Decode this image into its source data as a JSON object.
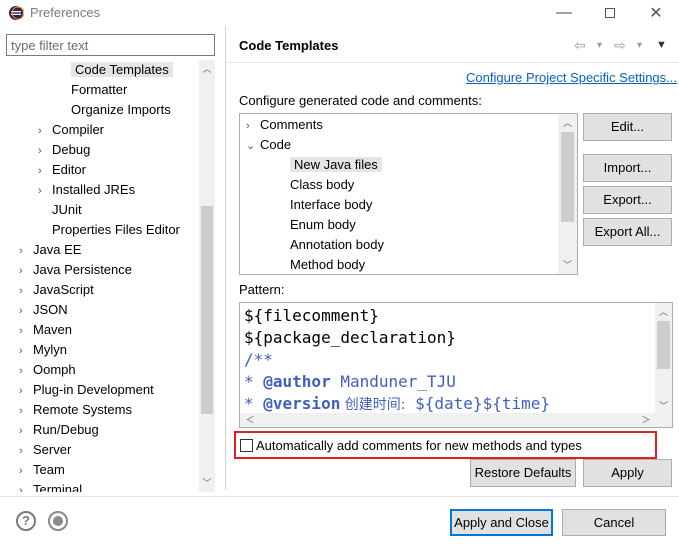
{
  "window": {
    "title": "Preferences",
    "minimize": "—",
    "close": "✕"
  },
  "filter": {
    "placeholder": "type filter text"
  },
  "left_tree": {
    "items": [
      {
        "label": "Code Templates",
        "indent": 3,
        "arrow": "",
        "selected": true
      },
      {
        "label": "Formatter",
        "indent": 3,
        "arrow": ""
      },
      {
        "label": "Organize Imports",
        "indent": 3,
        "arrow": ""
      },
      {
        "label": "Compiler",
        "indent": 2,
        "arrow": ">"
      },
      {
        "label": "Debug",
        "indent": 2,
        "arrow": ">"
      },
      {
        "label": "Editor",
        "indent": 2,
        "arrow": ">"
      },
      {
        "label": "Installed JREs",
        "indent": 2,
        "arrow": ">"
      },
      {
        "label": "JUnit",
        "indent": 2,
        "arrow": ""
      },
      {
        "label": "Properties Files Editor",
        "indent": 2,
        "arrow": ""
      },
      {
        "label": "Java EE",
        "indent": 1,
        "arrow": ">"
      },
      {
        "label": "Java Persistence",
        "indent": 1,
        "arrow": ">"
      },
      {
        "label": "JavaScript",
        "indent": 1,
        "arrow": ">"
      },
      {
        "label": "JSON",
        "indent": 1,
        "arrow": ">"
      },
      {
        "label": "Maven",
        "indent": 1,
        "arrow": ">"
      },
      {
        "label": "Mylyn",
        "indent": 1,
        "arrow": ">"
      },
      {
        "label": "Oomph",
        "indent": 1,
        "arrow": ">"
      },
      {
        "label": "Plug-in Development",
        "indent": 1,
        "arrow": ">"
      },
      {
        "label": "Remote Systems",
        "indent": 1,
        "arrow": ">"
      },
      {
        "label": "Run/Debug",
        "indent": 1,
        "arrow": ">"
      },
      {
        "label": "Server",
        "indent": 1,
        "arrow": ">"
      },
      {
        "label": "Team",
        "indent": 1,
        "arrow": ">"
      },
      {
        "label": "Terminal",
        "indent": 1,
        "arrow": ">"
      }
    ]
  },
  "header": {
    "title": "Code Templates",
    "configure_link": "Configure Project Specific Settings...",
    "description": "Configure generated code and comments:"
  },
  "templates_tree": {
    "items": [
      {
        "label": "Comments",
        "indent": 0,
        "arrow": ">"
      },
      {
        "label": "Code",
        "indent": 0,
        "arrow": "v"
      },
      {
        "label": "New Java files",
        "indent": 1,
        "arrow": "",
        "selected": true
      },
      {
        "label": "Class body",
        "indent": 1,
        "arrow": ""
      },
      {
        "label": "Interface body",
        "indent": 1,
        "arrow": ""
      },
      {
        "label": "Enum body",
        "indent": 1,
        "arrow": ""
      },
      {
        "label": "Annotation body",
        "indent": 1,
        "arrow": ""
      },
      {
        "label": "Method body",
        "indent": 1,
        "arrow": ""
      }
    ]
  },
  "side_buttons": {
    "edit": "Edit...",
    "import": "Import...",
    "export": "Export...",
    "export_all": "Export All..."
  },
  "pattern": {
    "label": "Pattern:",
    "line1": "${filecomment}",
    "line2": "${package_declaration}",
    "line3": "/**",
    "line4_star": "* ",
    "line4_tag": "@author",
    "line4_val": " Manduner_TJU",
    "line5_star": "* ",
    "line5_tag": "@version",
    "line5_cjk": " 创建时间:",
    "line5_val": " ${date}${time}"
  },
  "auto_comments": {
    "label": "Automatically add comments for new methods and types",
    "checked": false
  },
  "buttons": {
    "restore_defaults": "Restore Defaults",
    "apply": "Apply",
    "apply_and_close": "Apply and Close",
    "cancel": "Cancel"
  },
  "colors": {
    "link": "#0b5fc1",
    "highlight": "#e02020",
    "doc_comment": "#3f5fbf",
    "selection": "#e5e5e5"
  }
}
